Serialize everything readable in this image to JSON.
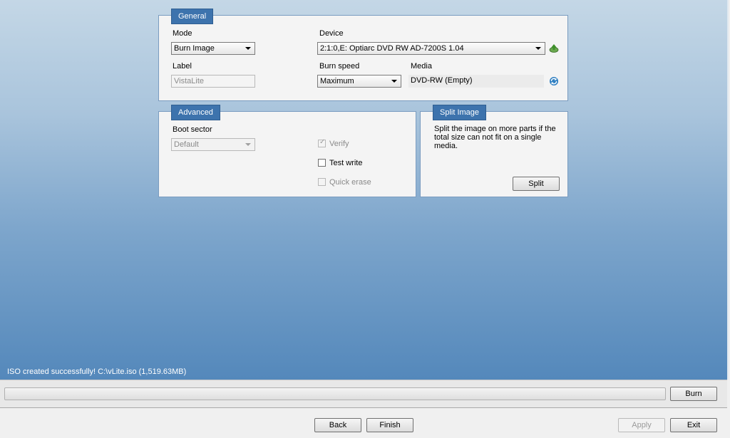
{
  "general": {
    "title": "General",
    "mode_label": "Mode",
    "mode_value": "Burn Image",
    "device_label": "Device",
    "device_value": "2:1:0,E: Optiarc  DVD RW AD-7200S  1.04",
    "label_label": "Label",
    "label_placeholder": "VistaLite",
    "burn_speed_label": "Burn speed",
    "burn_speed_value": "Maximum",
    "media_label": "Media",
    "media_value": "DVD-RW (Empty)",
    "eject_icon": "eject-disc-icon",
    "refresh_icon": "refresh-icon"
  },
  "advanced": {
    "title": "Advanced",
    "boot_sector_label": "Boot sector",
    "boot_sector_value": "Default",
    "verify_label": "Verify",
    "verify_checked": true,
    "test_write_label": "Test write",
    "test_write_checked": false,
    "quick_erase_label": "Quick erase",
    "quick_erase_checked": false
  },
  "split": {
    "title": "Split Image",
    "description": "Split the image on more parts if the total size can not fit on a single media.",
    "button": "Split"
  },
  "status": {
    "message": "ISO created successfully! C:\\vLite.iso (1,519.63MB)",
    "progress": 0
  },
  "buttons": {
    "burn": "Burn",
    "back": "Back",
    "finish": "Finish",
    "apply": "Apply",
    "exit": "Exit"
  },
  "colors": {
    "accent": "#3d73ad",
    "background_top": "#c4d7e6",
    "background_bottom": "#5488bb"
  }
}
